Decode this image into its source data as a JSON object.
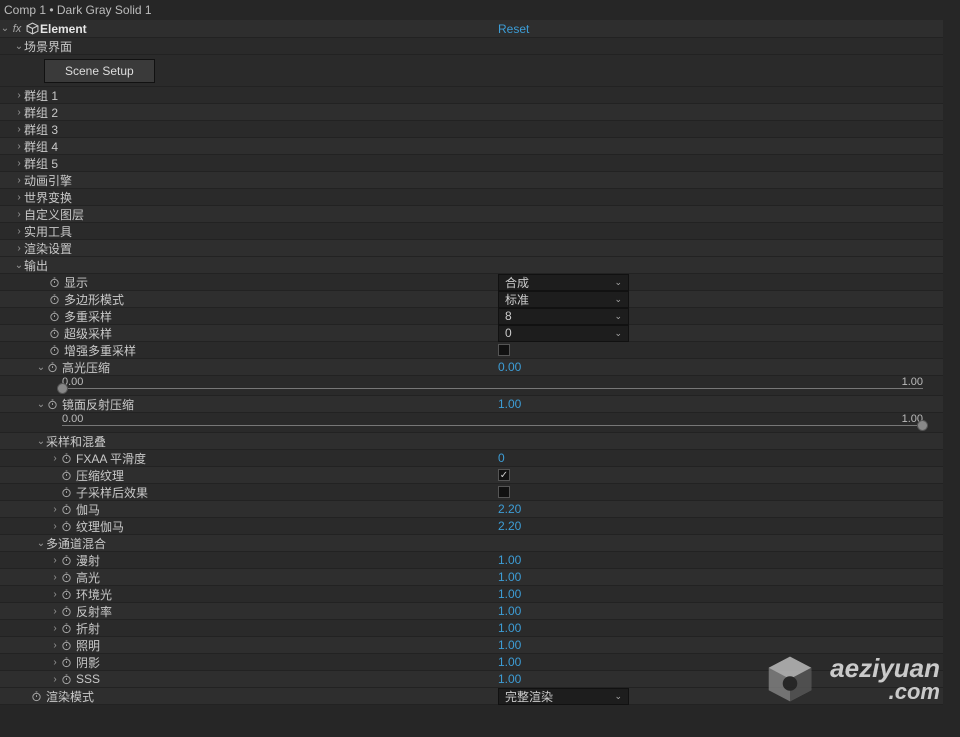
{
  "title": "Comp 1 • Dark Gray Solid 1",
  "effect": {
    "name": "Element",
    "reset": "Reset"
  },
  "scene": {
    "label": "场景界面",
    "button": "Scene Setup"
  },
  "groups": [
    "群组 1",
    "群组 2",
    "群组 3",
    "群组 4",
    "群组 5",
    "动画引擎",
    "世界变换",
    "自定义图层",
    "实用工具",
    "渲染设置"
  ],
  "output": {
    "label": "输出",
    "display": {
      "label": "显示",
      "value": "合成"
    },
    "polyMode": {
      "label": "多边形模式",
      "value": "标准"
    },
    "multisample": {
      "label": "多重采样",
      "value": "8"
    },
    "supersample": {
      "label": "超级采样",
      "value": "0"
    },
    "enhancedMS": {
      "label": "增强多重采样",
      "checked": false
    },
    "specComp": {
      "label": "高光压缩",
      "value": "0.00",
      "min": "0.00",
      "max": "1.00"
    },
    "mirrorComp": {
      "label": "镜面反射压缩",
      "value": "1.00",
      "min": "0.00",
      "max": "1.00"
    }
  },
  "sampling": {
    "label": "采样和混叠",
    "fxaa": {
      "label": "FXAA  平滑度",
      "value": "0"
    },
    "compTex": {
      "label": "压缩纹理",
      "checked": true
    },
    "subSamplePost": {
      "label": "子采样后效果",
      "checked": false
    },
    "gamma": {
      "label": "伽马",
      "value": "2.20"
    },
    "texGamma": {
      "label": "纹理伽马",
      "value": "2.20"
    }
  },
  "multipass": {
    "label": "多通道混合",
    "items": [
      {
        "label": "漫射",
        "value": "1.00"
      },
      {
        "label": "高光",
        "value": "1.00"
      },
      {
        "label": "环境光",
        "value": "1.00"
      },
      {
        "label": "反射率",
        "value": "1.00"
      },
      {
        "label": "折射",
        "value": "1.00"
      },
      {
        "label": "照明",
        "value": "1.00"
      },
      {
        "label": "阴影",
        "value": "1.00"
      },
      {
        "label": "SSS",
        "value": "1.00"
      }
    ]
  },
  "renderMode": {
    "label": "渲染模式",
    "value": "完整渲染"
  },
  "watermark": {
    "line1": "aeziyuan",
    "line2": ".com"
  }
}
